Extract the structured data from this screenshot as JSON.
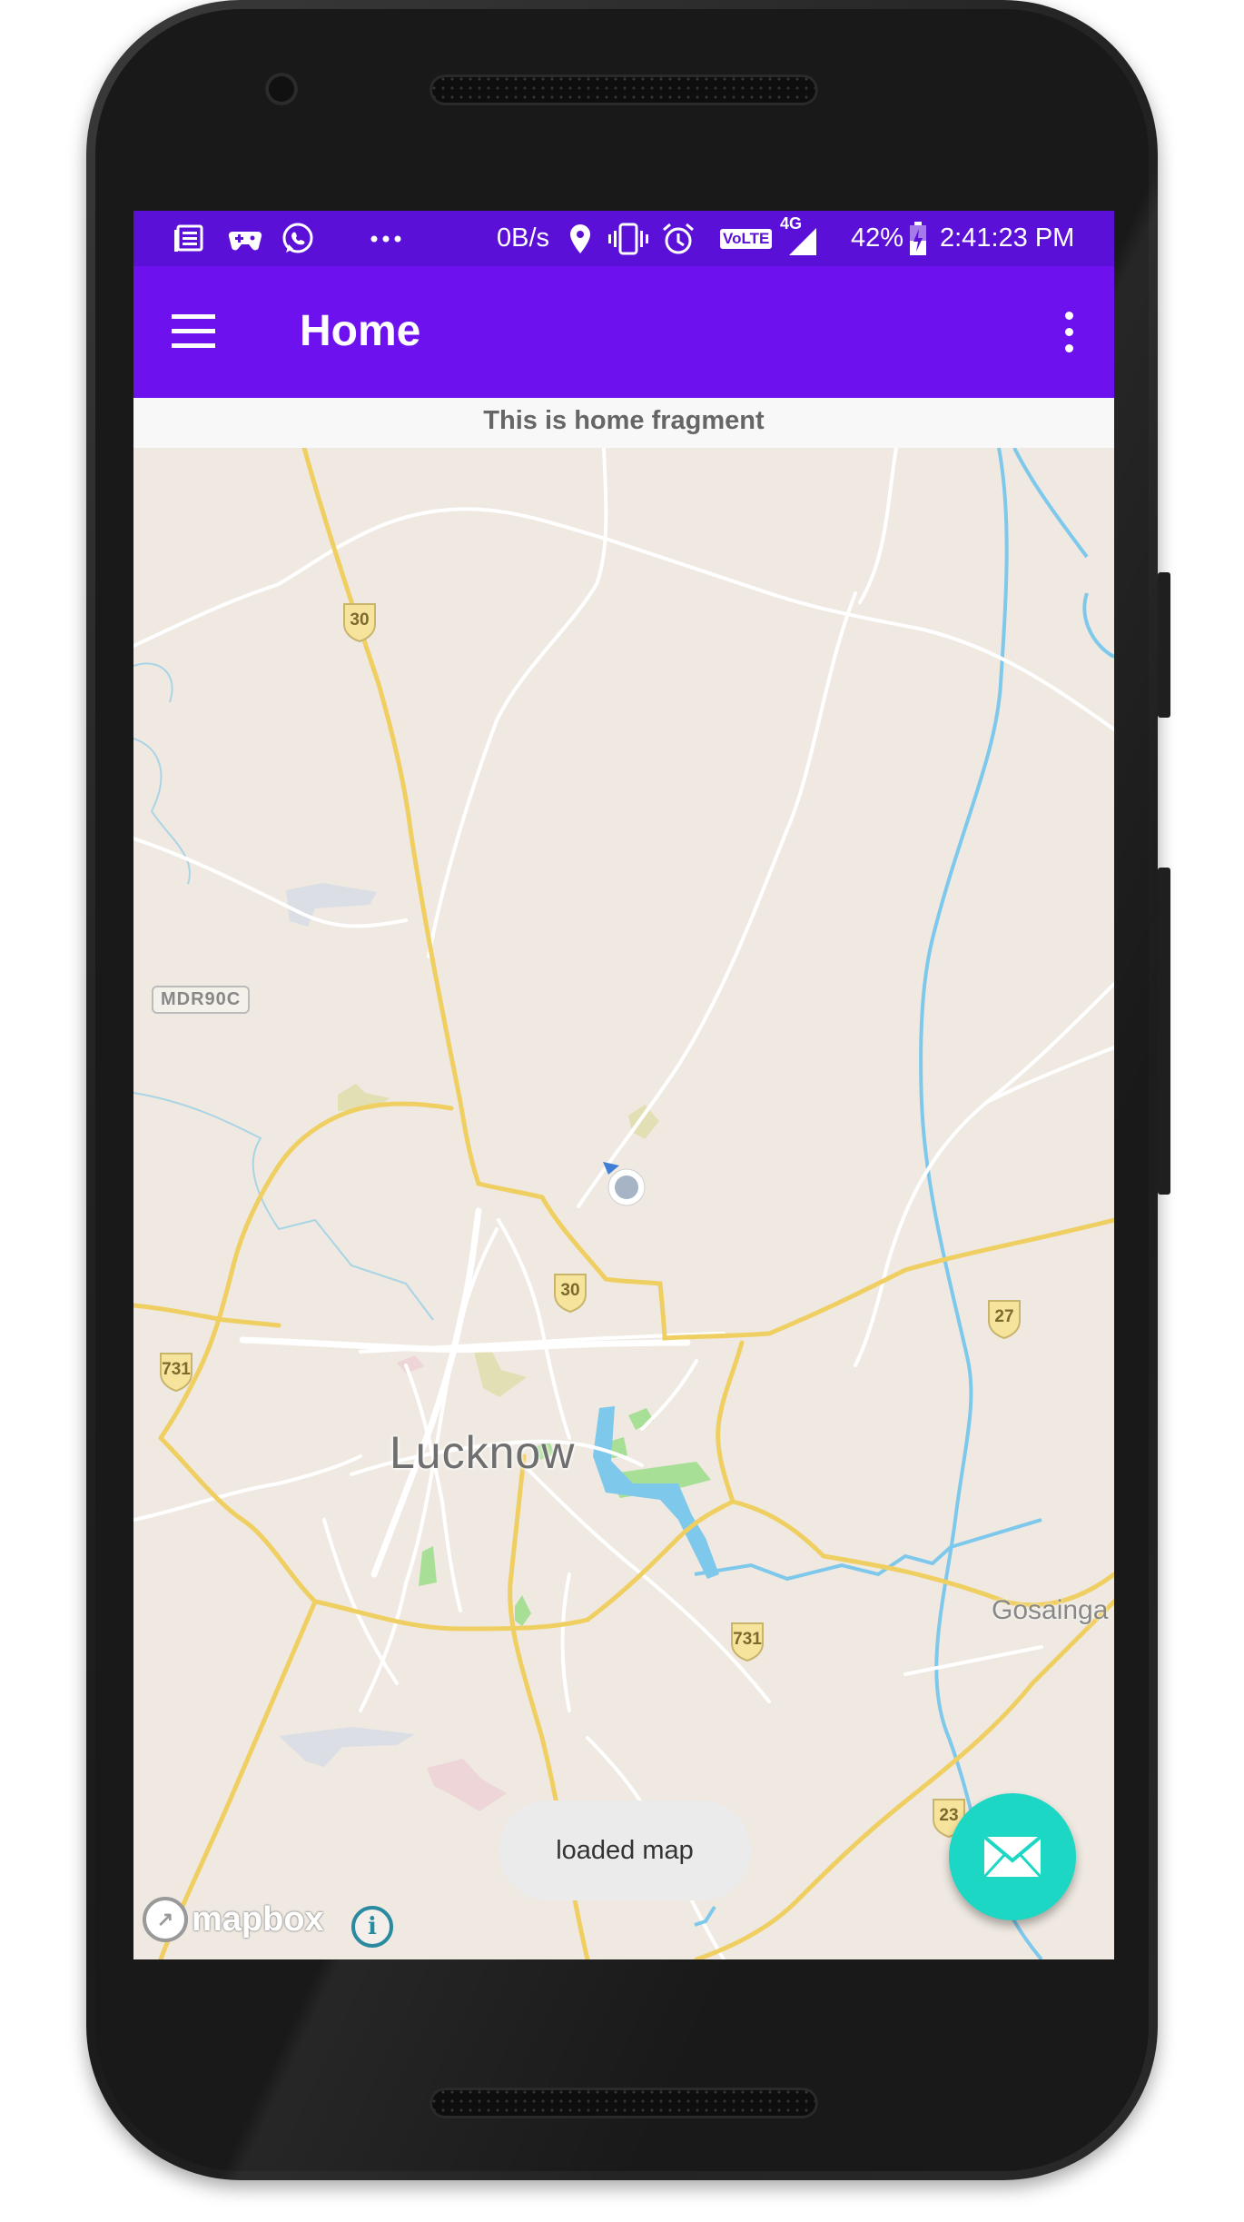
{
  "status_bar": {
    "network_speed": "0B/s",
    "volte": "VoLTE",
    "network_type": "4G",
    "battery": "42%",
    "time": "2:41:23 PM",
    "notification_icons": [
      "news-icon",
      "game-controller-icon",
      "whatsapp-icon",
      "more-dots-icon"
    ],
    "system_icons": [
      "location-icon",
      "vibrate-icon",
      "alarm-icon",
      "volte-icon",
      "signal-icon",
      "battery-charging-icon"
    ]
  },
  "toolbar": {
    "title": "Home",
    "menu_icon": "hamburger-menu-icon",
    "overflow_icon": "more-vert-icon"
  },
  "fragment": {
    "text": "This is home fragment"
  },
  "map": {
    "city": "Lucknow",
    "town": "Gosainga",
    "route_labels": [
      "30",
      "30",
      "731",
      "731",
      "27",
      "23"
    ],
    "mdr_label": "MDR90C",
    "attribution": "mapbox",
    "info_icon": "info-icon",
    "user_location_icon": "user-location-icon"
  },
  "toast": {
    "text": "loaded map"
  },
  "fab": {
    "icon": "email-icon",
    "color": "#1cd7c3"
  },
  "colors": {
    "status_bar": "#5a10d6",
    "toolbar": "#6d12ee",
    "map_bg": "#efe9e1",
    "highway": "#f0cf62",
    "water": "#7ec8ec"
  }
}
